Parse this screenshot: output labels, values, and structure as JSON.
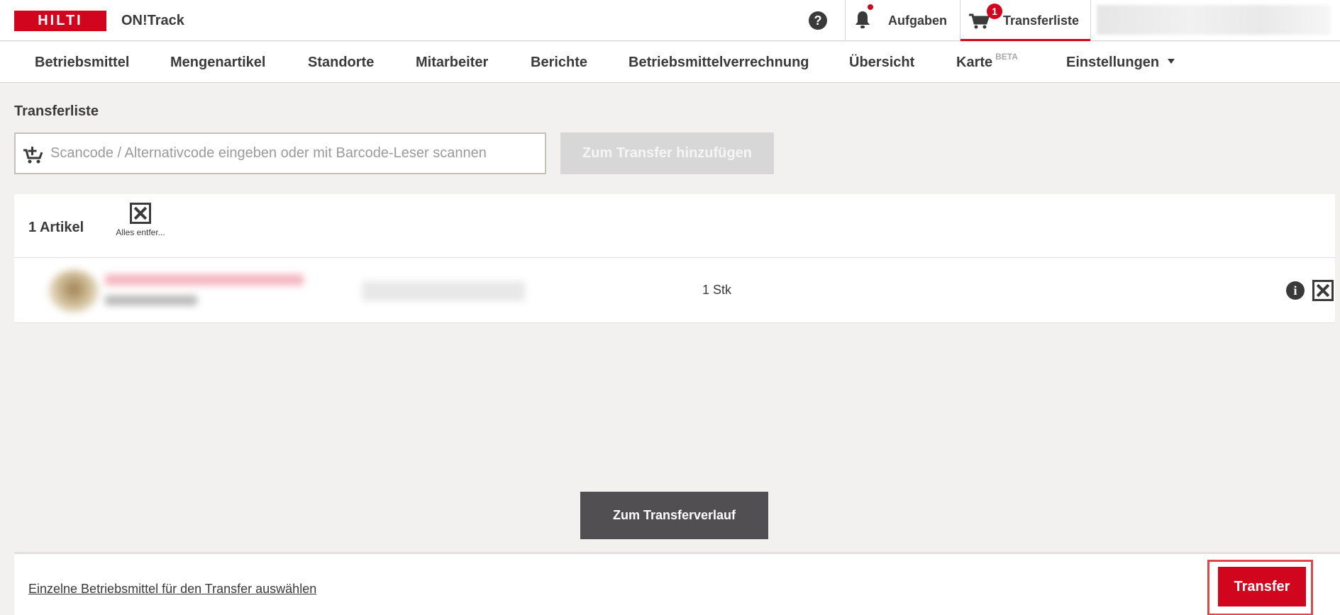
{
  "header": {
    "logo_text": "HILTI",
    "app_name": "ON!Track",
    "help_icon": "question-circle-icon",
    "tasks_label": "Aufgaben",
    "transfer_list_label": "Transferliste",
    "transfer_list_count": "1",
    "brand_color": "#d2051e"
  },
  "nav": {
    "items": [
      {
        "label": "Betriebsmittel"
      },
      {
        "label": "Mengenartikel"
      },
      {
        "label": "Standorte"
      },
      {
        "label": "Mitarbeiter"
      },
      {
        "label": "Berichte"
      },
      {
        "label": "Betriebsmittelverrechnung"
      },
      {
        "label": "Übersicht"
      },
      {
        "label": "Karte",
        "badge": "BETA"
      },
      {
        "label": "Einstellungen"
      }
    ]
  },
  "page": {
    "title": "Transferliste",
    "scan_placeholder": "Scancode / Alternativcode eingeben oder mit Barcode-Leser scannen",
    "scan_value": "",
    "add_button": "Zum Transfer hinzufügen"
  },
  "list": {
    "count_label": "1 Artikel",
    "clear_all_label": "Alles entfer...",
    "items": [
      {
        "quantity": "1 Stk"
      }
    ]
  },
  "history_button": "Zum Transferverlauf",
  "footer": {
    "select_link": "Einzelne Betriebsmittel für den Transfer auswählen",
    "transfer_button": "Transfer"
  }
}
